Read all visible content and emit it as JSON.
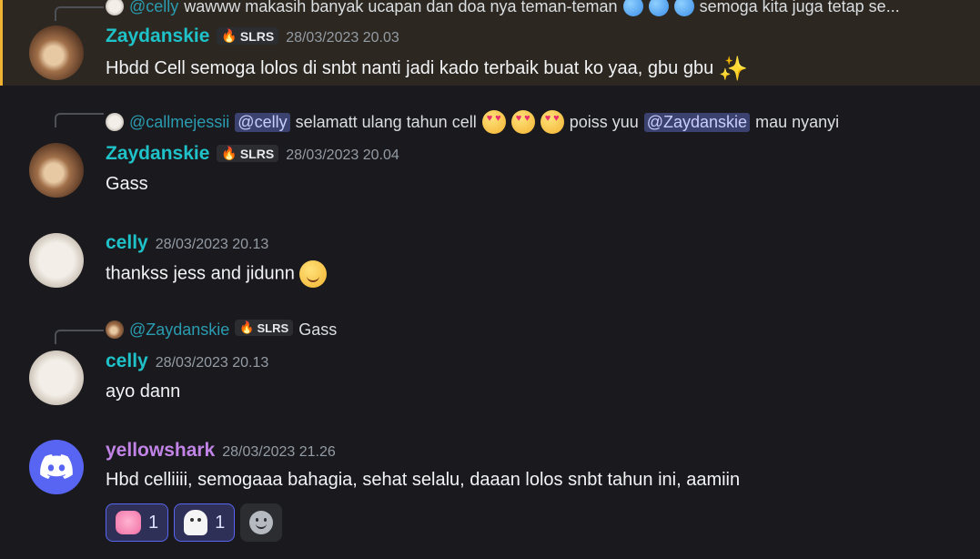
{
  "messages": [
    {
      "reply": {
        "mention": "@celly",
        "text": "wawww makasih banyak ucapan dan doa nya teman-teman",
        "text_after": "semoga kita juga tetap se..."
      },
      "author": "Zaydanskie",
      "tag": "SLRS",
      "timestamp": "28/03/2023 20.03",
      "content": "Hbdd Cell semoga lolos di snbt nanti jadi kado terbaik buat ko yaa, gbu gbu"
    },
    {
      "reply": {
        "author": "@callmejessii",
        "mention": "@celly",
        "text": "selamatt ulang tahun cell",
        "text_mid": "poiss yuu",
        "mention2": "@Zaydanskie",
        "text_after": "mau nyanyi"
      },
      "author": "Zaydanskie",
      "tag": "SLRS",
      "timestamp": "28/03/2023 20.04",
      "content": "Gass"
    },
    {
      "author": "celly",
      "timestamp": "28/03/2023 20.13",
      "content": "thankss jess and jidunn"
    },
    {
      "reply": {
        "author": "@Zaydanskie",
        "tag": "SLRS",
        "text": "Gass"
      },
      "author": "celly",
      "timestamp": "28/03/2023 20.13",
      "content": "ayo dann"
    },
    {
      "author": "yellowshark",
      "timestamp": "28/03/2023 21.26",
      "content": "Hbd celliiii, semogaaa bahagia, sehat selalu, daaan  lolos snbt tahun ini, aamiin",
      "reactions": [
        {
          "emoji": "heart-sparkle-icon",
          "count": "1"
        },
        {
          "emoji": "ghost-icon",
          "count": "1"
        }
      ]
    }
  ],
  "colors": {
    "background": "#1a1a1e",
    "highlight": "#2c2821",
    "highlight_bar": "#f0b232",
    "username_teal": "#1ec2c8",
    "username_violet": "#c184e6",
    "discord_blurple": "#5865f2"
  }
}
